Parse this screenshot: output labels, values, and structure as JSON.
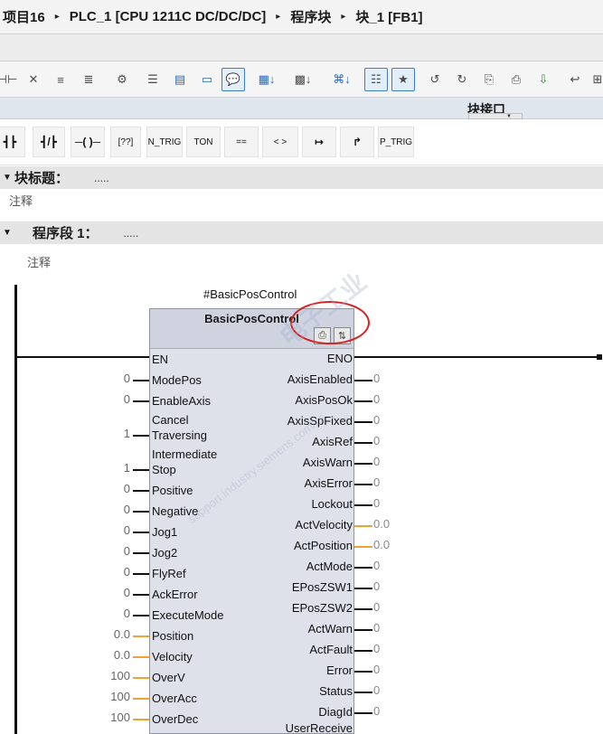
{
  "breadcrumb": [
    "项目16",
    "PLC_1 [CPU 1211C DC/DC/DC]",
    "程序块",
    "块_1 [FB1]"
  ],
  "toolbar": {
    "icons": [
      "open-contact-icon",
      "delete-contact-icon",
      "insert-network-icon",
      "delete-network-icon",
      "monitor-icon",
      "abs-display-icon",
      "sym-display-icon",
      "rung-icon",
      "comment-icon",
      "network-expand-icon",
      "network-collapse-icon",
      "import-icon",
      "export-icon",
      "open-all-icon",
      "favorites-icon",
      "block-call-icon",
      "jump-icon",
      "go-online-icon",
      "go-offline-icon",
      "monitor-on-icon",
      "monitor-off-icon",
      "compile-icon"
    ]
  },
  "interface": {
    "label": "块接口"
  },
  "palette": {
    "no_contact": "┫┣",
    "nc_contact": "┫/┣",
    "coil": "─( )─",
    "box": "[??]",
    "n_trig": "N_TRIG",
    "ton": "TON",
    "cmp_eq": "==",
    "cmp_ne": "< >",
    "jump": "↦",
    "branch": "↱",
    "p_trig": "P_TRIG"
  },
  "block": {
    "title_label": "块标题：",
    "title_dots": ".....",
    "comment": "注释"
  },
  "network": {
    "label": "程序段 1：",
    "dots": ".....",
    "comment": "注释"
  },
  "fb": {
    "instance": "#BasicPosControl",
    "name": "BasicPosControl",
    "inputs": [
      {
        "pin": "EN",
        "value": ""
      },
      {
        "pin": "ModePos",
        "value": "0"
      },
      {
        "pin": "EnableAxis",
        "value": "0"
      },
      {
        "pin": "Cancel Traversing",
        "line1": "Cancel",
        "line2": "Traversing",
        "value": "1"
      },
      {
        "pin": "Intermediate Stop",
        "line1": "Intermediate",
        "line2": "Stop",
        "value": "1"
      },
      {
        "pin": "Positive",
        "value": "0"
      },
      {
        "pin": "Negative",
        "value": "0"
      },
      {
        "pin": "Jog1",
        "value": "0"
      },
      {
        "pin": "Jog2",
        "value": "0"
      },
      {
        "pin": "FlyRef",
        "value": "0"
      },
      {
        "pin": "AckError",
        "value": "0"
      },
      {
        "pin": "ExecuteMode",
        "value": "0"
      },
      {
        "pin": "Position",
        "value": "0.0"
      },
      {
        "pin": "Velocity",
        "value": "0.0"
      },
      {
        "pin": "OverV",
        "value": "100"
      },
      {
        "pin": "OverAcc",
        "value": "100"
      },
      {
        "pin": "OverDec",
        "value": "100"
      }
    ],
    "outputs": [
      {
        "pin": "ENO",
        "value": ""
      },
      {
        "pin": "AxisEnabled",
        "value": "0"
      },
      {
        "pin": "AxisPosOk",
        "value": "0"
      },
      {
        "pin": "AxisSpFixed",
        "value": "0"
      },
      {
        "pin": "AxisRef",
        "value": "0"
      },
      {
        "pin": "AxisWarn",
        "value": "0"
      },
      {
        "pin": "AxisError",
        "value": "0"
      },
      {
        "pin": "Lockout",
        "value": "0"
      },
      {
        "pin": "ActVelocity",
        "value": "0.0"
      },
      {
        "pin": "ActPosition",
        "value": "0.0"
      },
      {
        "pin": "ActMode",
        "value": "0"
      },
      {
        "pin": "EPosZSW1",
        "value": "0"
      },
      {
        "pin": "EPosZSW2",
        "value": "0"
      },
      {
        "pin": "ActWarn",
        "value": "0"
      },
      {
        "pin": "ActFault",
        "value": "0"
      },
      {
        "pin": "Error",
        "value": "0"
      },
      {
        "pin": "Status",
        "value": "0"
      },
      {
        "pin": "DiagId",
        "value": "0"
      },
      {
        "pin": "UserReceive",
        "value": ""
      }
    ]
  },
  "watermark": {
    "line1": "电子工业",
    "line2": "support.industry.siemens.com/cs"
  },
  "colors": {
    "annotation_circle": "#d32222",
    "bool_stub": "#111111",
    "numeric_stub": "#f0a23a",
    "fb_body": "#dfe1ea"
  }
}
